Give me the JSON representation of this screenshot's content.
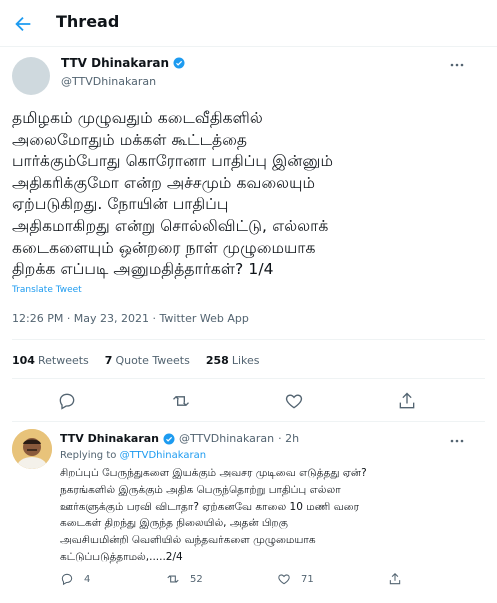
{
  "header": {
    "title": "Thread"
  },
  "tweet": {
    "name": "TTV Dhinakaran",
    "handle": "@TTVDhinakaran",
    "text_lines": [
      "தமிழகம் முழுவதும் கடைவீதிகளில்",
      "அலைமோதும் மக்கள் கூட்டத்தை",
      "பார்க்கும்போது கொரோனா பாதிப்பு இன்னும்",
      "அதிகரிக்குமோ என்ற அச்சமும் கவலையும்",
      "ஏற்படுகிறது. நோயின் பாதிப்பு",
      "அதிகமாகிறது என்று சொல்லிவிட்டு, எல்லாக்",
      "கடைகளையும் ஒன்றரை நாள் முழுமையாக",
      "திறக்க எப்படி அனுமதித்தார்கள்? 1/4"
    ],
    "translate": "Translate Tweet",
    "meta": "12:26 PM · May 23, 2021 · Twitter Web App",
    "stats": {
      "retweets_count": "104",
      "retweets_label": "Retweets",
      "quotes_count": "7",
      "quotes_label": "Quote Tweets",
      "likes_count": "258",
      "likes_label": "Likes"
    }
  },
  "reply": {
    "name": "TTV Dhinakaran",
    "handle": "@TTVDhinakaran",
    "time": "· 2h",
    "replying_prefix": "Replying to",
    "replying_to": "@TTVDhinakaran",
    "text_lines": [
      "சிறப்புப் பேருந்துகளை இயக்கும் அவசர முடிவை எடுத்தது ஏன்?",
      "நகரங்களில் இருக்கும் அதிக பெருந்தொற்று பாதிப்பு எல்லா",
      "ஊர்களுக்கும் பரவி விடாதா? ஏற்கனவே காலை 10 மணி வரை",
      "கடைகள் திறந்து இருந்த நிலையில், அதன் பிறகு",
      "அவசியமின்றி வெளியில் வந்தவர்களை  முழுமையாக",
      "கட்டுப்படுத்தாமல்,.....2/4"
    ],
    "replies": "4",
    "retweets": "52",
    "likes": "71"
  },
  "colors": {
    "accent": "#1d9bf0",
    "muted": "#536471",
    "text": "#0f1419"
  }
}
